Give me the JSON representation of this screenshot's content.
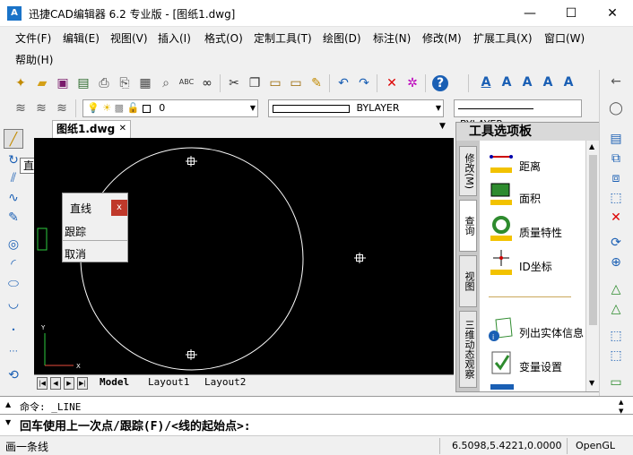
{
  "window": {
    "title": "迅捷CAD编辑器 6.2 专业版 - [图纸1.dwg]",
    "app_icon_text": "A",
    "minimize": "—",
    "maximize": "☐",
    "close": "✕"
  },
  "menu": {
    "row1": [
      "文件(F)",
      "编辑(E)",
      "视图(V)",
      "插入(I)",
      "格式(O)",
      "定制工具(T)",
      "绘图(D)",
      "标注(N)",
      "修改(M)",
      "扩展工具(X)",
      "窗口(W)"
    ],
    "row2": [
      "帮助(H)"
    ]
  },
  "toolbar2": {
    "layer_value": "0",
    "linetype_value": "BYLAYER",
    "lineweight_value": "BYLAYER"
  },
  "tooltip": "直线",
  "document": {
    "tab_label": "图纸1.dwg",
    "tab_close": "✕"
  },
  "canvas": {
    "ucs_x": "X",
    "ucs_y": "Y"
  },
  "layout_tabs": [
    "Model",
    "Layout1",
    "Layout2"
  ],
  "popup": {
    "title": "直线",
    "close": "x",
    "items": [
      "跟踪",
      "取消"
    ]
  },
  "palette": {
    "title": "工具选项板",
    "side_tabs": [
      "修改(M)",
      "查询",
      "视图",
      "三维动态观察"
    ],
    "items": [
      "距离",
      "面积",
      "质量特性",
      "ID坐标",
      "列出实体信息",
      "变量设置"
    ]
  },
  "command": {
    "line1": "命令:  _LINE",
    "line2": "回车使用上一次点/跟踪(F)/<线的起始点>:"
  },
  "status": {
    "left": "画一条线",
    "coords": "6.5098,5.4221,0.0000",
    "renderer": "OpenGL"
  },
  "colors": {
    "canvas_bg": "#000000",
    "accent_blue": "#1a73c8",
    "close_red": "#c0392b"
  }
}
